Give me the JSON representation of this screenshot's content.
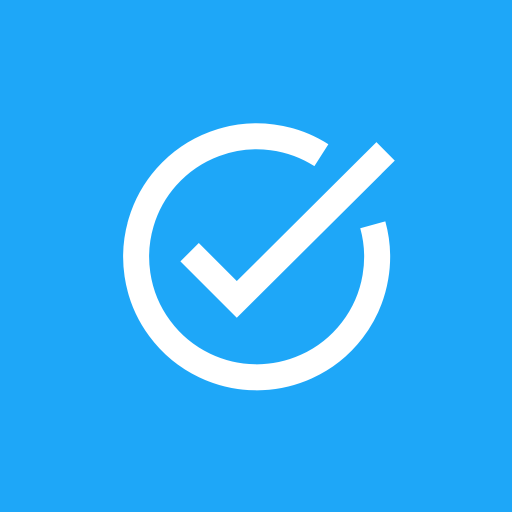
{
  "icon": {
    "name": "check-circle-icon",
    "background_color": "#1EA7F8",
    "foreground_color": "#FFFFFF"
  }
}
